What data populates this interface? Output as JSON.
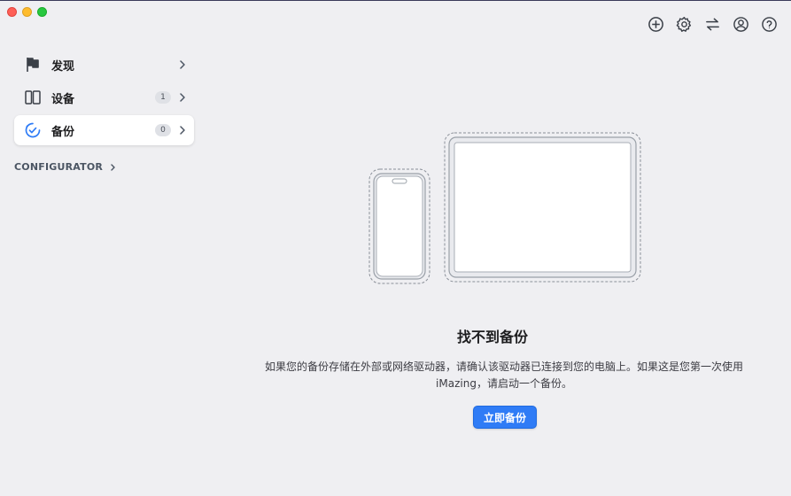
{
  "window": {
    "controls": [
      "close",
      "minimize",
      "maximize"
    ]
  },
  "toolbar": {
    "icons": [
      "plus-circle-icon",
      "gear-icon",
      "transfer-arrows-icon",
      "account-icon",
      "help-icon"
    ]
  },
  "sidebar": {
    "items": [
      {
        "label": "发现",
        "icon": "flag-icon",
        "badge": null,
        "active": false
      },
      {
        "label": "设备",
        "icon": "devices-icon",
        "badge": "1",
        "active": false
      },
      {
        "label": "备份",
        "icon": "backup-icon",
        "badge": "0",
        "active": true
      }
    ],
    "section_label": "CONFIGURATOR"
  },
  "empty_state": {
    "title": "找不到备份",
    "description_line1": "如果您的备份存储在外部或网络驱动器，请确认该驱动器已连接到您的电脑上。如果这是您第一次使用",
    "description_line2": "iMazing，请启动一个备份。",
    "button_label": "立即备份"
  },
  "colors": {
    "accent": "#2f7cf6",
    "backup_icon": "#2f7cf6",
    "background": "#efeff2"
  }
}
